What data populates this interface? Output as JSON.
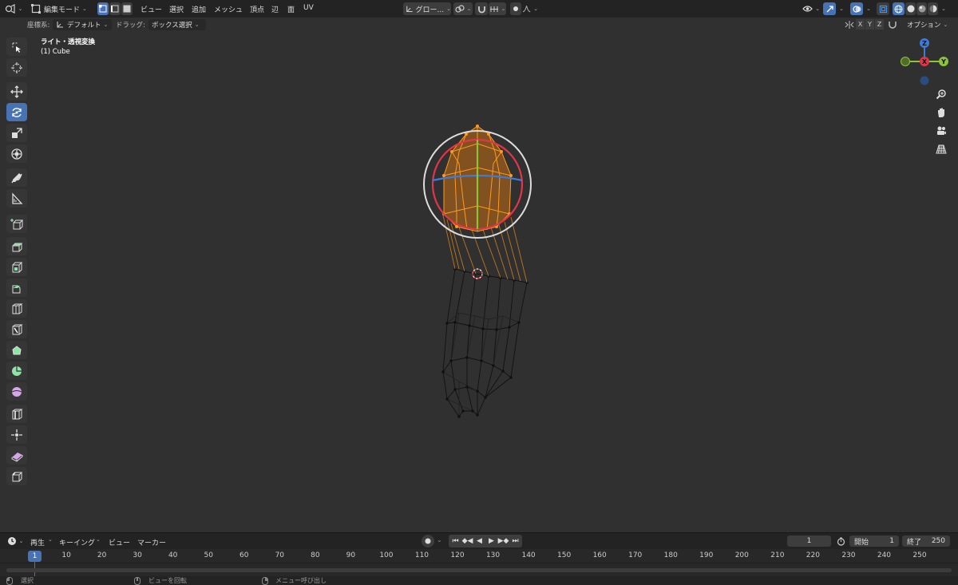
{
  "header": {
    "mode_label": "編集モード",
    "menus": [
      "ビュー",
      "選択",
      "追加",
      "メッシュ",
      "頂点",
      "辺",
      "面",
      "UV"
    ],
    "transform_orientation": "グロー...",
    "option_label": "オプション"
  },
  "tool_settings": {
    "coord_label": "座標系:",
    "coord_value": "デフォルト",
    "drag_label": "ドラッグ:",
    "drag_value": "ボックス選択",
    "axes": [
      "X",
      "Y",
      "Z"
    ]
  },
  "viewport": {
    "view_name": "ライト・透視変換",
    "object_name": "(1) Cube",
    "gizmo_axes": [
      "Z",
      "X",
      "Y"
    ]
  },
  "tools": [
    {
      "name": "select-box-tool",
      "icon": "select-box-icon"
    },
    {
      "name": "cursor-tool",
      "icon": "cursor-icon"
    },
    {
      "name": "move-tool",
      "icon": "move-icon"
    },
    {
      "name": "rotate-tool",
      "icon": "rotate-icon",
      "active": true
    },
    {
      "name": "scale-tool",
      "icon": "scale-icon"
    },
    {
      "name": "transform-tool",
      "icon": "transform-icon"
    },
    {
      "name": "annotate-tool",
      "icon": "annotate-icon"
    },
    {
      "name": "measure-tool",
      "icon": "measure-icon"
    },
    {
      "name": "add-cube-tool",
      "icon": "add-cube-icon"
    },
    {
      "name": "extrude-tool",
      "icon": "extrude-icon"
    },
    {
      "name": "inset-tool",
      "icon": "inset-icon"
    },
    {
      "name": "bevel-tool",
      "icon": "bevel-icon"
    },
    {
      "name": "loop-cut-tool",
      "icon": "loop-cut-icon"
    },
    {
      "name": "knife-tool",
      "icon": "knife-icon"
    },
    {
      "name": "poly-build-tool",
      "icon": "poly-build-icon"
    },
    {
      "name": "spin-tool",
      "icon": "spin-icon"
    },
    {
      "name": "smooth-tool",
      "icon": "smooth-icon"
    },
    {
      "name": "edge-slide-tool",
      "icon": "edge-slide-icon"
    },
    {
      "name": "shrink-fatten-tool",
      "icon": "shrink-fatten-icon"
    },
    {
      "name": "shear-tool",
      "icon": "shear-icon"
    },
    {
      "name": "rip-region-tool",
      "icon": "rip-region-icon"
    }
  ],
  "timeline": {
    "menus": [
      "再生",
      "キーイング",
      "ビュー",
      "マーカー"
    ],
    "current_frame": "1",
    "start_label": "開始",
    "start_value": "1",
    "end_label": "終了",
    "end_value": "250",
    "ticks": [
      "1",
      "10",
      "20",
      "30",
      "40",
      "50",
      "60",
      "70",
      "80",
      "90",
      "100",
      "110",
      "120",
      "130",
      "140",
      "150",
      "160",
      "170",
      "180",
      "190",
      "200",
      "210",
      "220",
      "230",
      "240",
      "250"
    ]
  },
  "statusbar": {
    "select": "選択",
    "rotate_view": "ビューを回転",
    "call_menu": "メニュー呼び出し"
  },
  "colors": {
    "accent": "#4772b3",
    "selected": "#ff9a1f",
    "axis_x": "#e0364b",
    "axis_y": "#8bc43b",
    "axis_z": "#3d7bd6"
  }
}
